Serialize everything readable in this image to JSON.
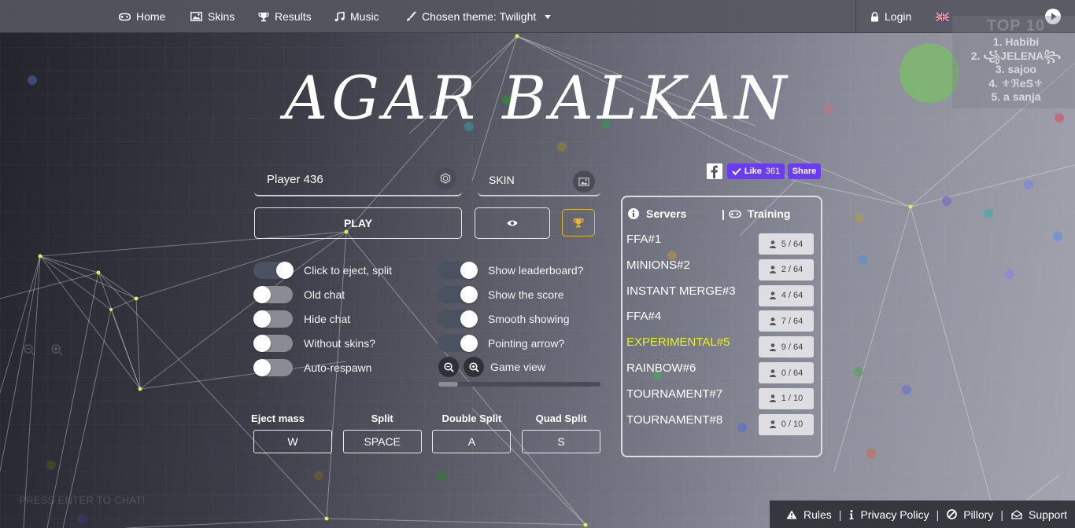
{
  "nav": {
    "home": "Home",
    "skins": "Skins",
    "results": "Results",
    "music": "Music",
    "theme": "Chosen theme: Twilight",
    "login": "Login"
  },
  "leaderboard": {
    "title": "TOP 10",
    "entries": [
      "1. Habibi",
      "2. ꧁JELENA꧂",
      "3. sajoo",
      "4. ⚜ℜeS⚜",
      "5. a sanja"
    ]
  },
  "title": "AGAR BALKAN",
  "player": {
    "nickname": "Player 436",
    "skin_placeholder": "SKIN"
  },
  "buttons": {
    "play": "PLAY"
  },
  "options_left": [
    {
      "label": "Click to eject, split",
      "on": true
    },
    {
      "label": "Old chat",
      "on": false
    },
    {
      "label": "Hide chat",
      "on": false
    },
    {
      "label": "Without skins?",
      "on": false
    },
    {
      "label": "Auto-respawn",
      "on": false
    }
  ],
  "options_right": [
    {
      "label": "Show leaderboard?",
      "on": true
    },
    {
      "label": "Show the score",
      "on": true
    },
    {
      "label": "Smooth showing",
      "on": true
    },
    {
      "label": "Pointing arrow?",
      "on": true
    }
  ],
  "game_view": {
    "label": "Game view",
    "level": 0.12
  },
  "hotkeys": [
    {
      "label": "Eject mass",
      "key": "W"
    },
    {
      "label": "Split",
      "key": "SPACE"
    },
    {
      "label": "Double Split",
      "key": "A"
    },
    {
      "label": "Quad Split",
      "key": "S"
    }
  ],
  "social": {
    "like": "Like",
    "like_count": "361",
    "share": "Share"
  },
  "servers": {
    "tab_servers": "Servers",
    "tab_training": "Training",
    "list": [
      {
        "name": "FFA#1",
        "count": "5 / 64",
        "active": false
      },
      {
        "name": "MINIONS#2",
        "count": "2 / 64",
        "active": false
      },
      {
        "name": "INSTANT MERGE#3",
        "count": "4 / 64",
        "active": false
      },
      {
        "name": "FFA#4",
        "count": "7 / 64",
        "active": false
      },
      {
        "name": "EXPERIMENTAL#5",
        "count": "9 / 64",
        "active": true
      },
      {
        "name": "RAINBOW#6",
        "count": "0 / 64",
        "active": false
      },
      {
        "name": "TOURNAMENT#7",
        "count": "1 / 10",
        "active": false
      },
      {
        "name": "TOURNAMENT#8",
        "count": "0 / 10",
        "active": false
      }
    ]
  },
  "chat_hint": "PRESS ENTER TO CHAT!",
  "footer": {
    "rules": "Rules",
    "privacy": "Privacy Policy",
    "pillory": "Pillory",
    "support": "Support"
  },
  "colors": {
    "accent_gold": "#e3b53a",
    "highlight_server": "#e8ec2a",
    "facebook_like": "#6a3cf5"
  }
}
